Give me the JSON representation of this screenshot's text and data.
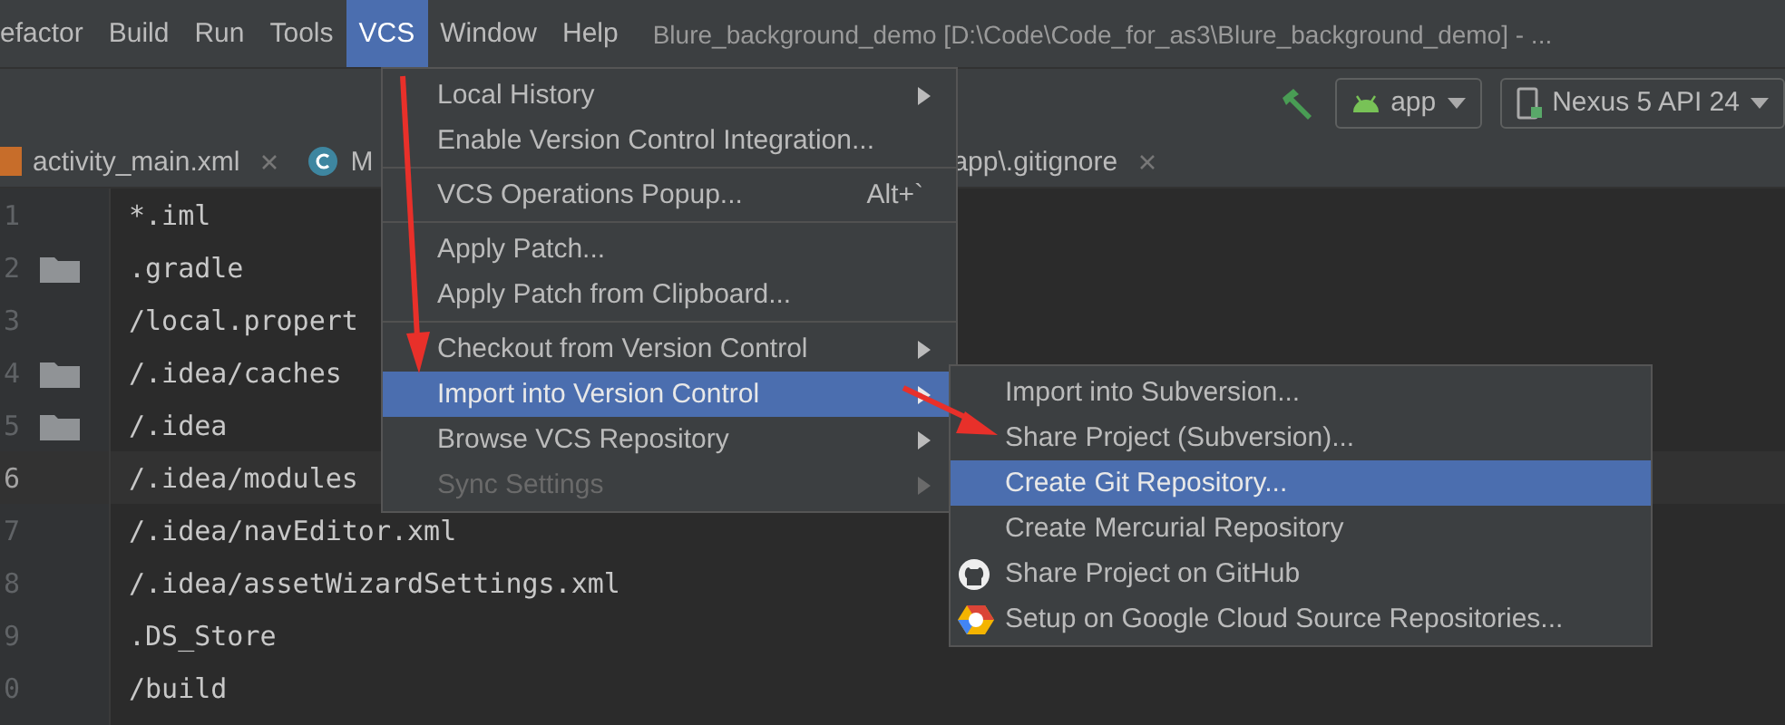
{
  "menu_bar": {
    "items": [
      {
        "label": "efactor",
        "selected": false
      },
      {
        "label": "Build",
        "selected": false
      },
      {
        "label": "Run",
        "selected": false
      },
      {
        "label": "Tools",
        "selected": false
      },
      {
        "label": "VCS",
        "selected": true
      },
      {
        "label": "Window",
        "selected": false
      },
      {
        "label": "Help",
        "selected": false
      }
    ],
    "window_title": "Blure_background_demo [D:\\Code\\Code_for_as3\\Blure_background_demo] - ..."
  },
  "toolbar": {
    "run_config": "app",
    "device": "Nexus 5 API 24"
  },
  "tabs": [
    {
      "label": "activity_main.xml"
    },
    {
      "label": "M"
    },
    {
      "label": "app\\.gitignore"
    }
  ],
  "editor": {
    "lines": [
      {
        "number": "1",
        "text": "*.iml",
        "folder": false,
        "current": false
      },
      {
        "number": "2",
        "text": ".gradle",
        "folder": true,
        "current": false
      },
      {
        "number": "3",
        "text": "/local.propert",
        "folder": false,
        "current": false
      },
      {
        "number": "4",
        "text": "/.idea/caches",
        "folder": true,
        "current": false
      },
      {
        "number": "5",
        "text": "/.idea",
        "folder": true,
        "current": false
      },
      {
        "number": "6",
        "text": "/.idea/modules",
        "folder": false,
        "current": true
      },
      {
        "number": "7",
        "text": "/.idea/navEditor.xml",
        "folder": false,
        "current": false
      },
      {
        "number": "8",
        "text": "/.idea/assetWizardSettings.xml",
        "folder": false,
        "current": false
      },
      {
        "number": "9",
        "text": ".DS_Store",
        "folder": false,
        "current": false
      },
      {
        "number": "0",
        "text": "/build",
        "folder": false,
        "current": false
      }
    ]
  },
  "vcs_menu": {
    "items": [
      {
        "kind": "item",
        "label": "Local History",
        "submenu": true,
        "selected": false,
        "disabled": false
      },
      {
        "kind": "item",
        "label": "Enable Version Control Integration...",
        "submenu": false,
        "selected": false,
        "disabled": false
      },
      {
        "kind": "separator"
      },
      {
        "kind": "item",
        "label": "VCS Operations Popup...",
        "shortcut": "Alt+`",
        "submenu": false,
        "selected": false,
        "disabled": false
      },
      {
        "kind": "separator"
      },
      {
        "kind": "item",
        "label": "Apply Patch...",
        "submenu": false,
        "selected": false,
        "disabled": false
      },
      {
        "kind": "item",
        "label": "Apply Patch from Clipboard...",
        "submenu": false,
        "selected": false,
        "disabled": false
      },
      {
        "kind": "separator"
      },
      {
        "kind": "item",
        "label": "Checkout from Version Control",
        "submenu": true,
        "selected": false,
        "disabled": false
      },
      {
        "kind": "item",
        "label": "Import into Version Control",
        "submenu": true,
        "selected": true,
        "disabled": false
      },
      {
        "kind": "item",
        "label": "Browse VCS Repository",
        "submenu": true,
        "selected": false,
        "disabled": false
      },
      {
        "kind": "item",
        "label": "Sync Settings",
        "submenu": true,
        "selected": false,
        "disabled": true
      }
    ]
  },
  "import_submenu": {
    "items": [
      {
        "label": "Import into Subversion...",
        "selected": false
      },
      {
        "label": "Share Project (Subversion)...",
        "selected": false
      },
      {
        "label": "Create Git Repository...",
        "selected": true
      },
      {
        "label": "Create Mercurial Repository",
        "selected": false
      },
      {
        "label": "Share Project on GitHub",
        "selected": false
      },
      {
        "label": "Setup on Google Cloud Source Repositories...",
        "selected": false
      }
    ]
  },
  "annotation_arrows": [
    {
      "kind": "arrow"
    },
    {
      "kind": "arrow"
    }
  ]
}
